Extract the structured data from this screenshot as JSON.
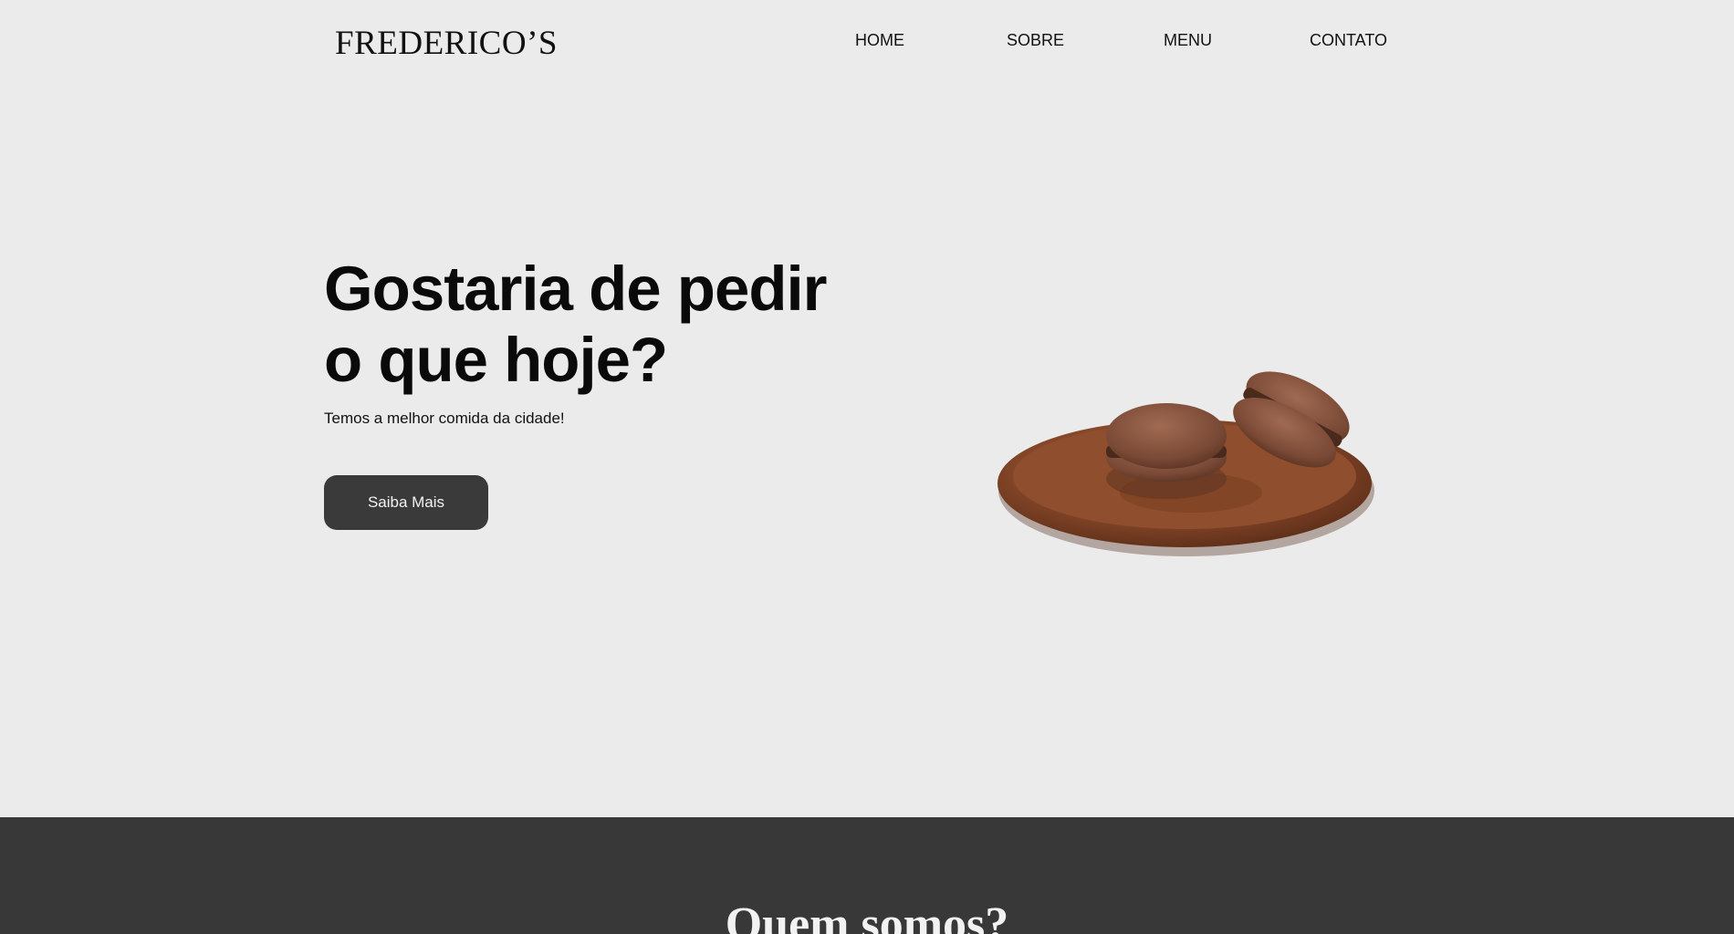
{
  "header": {
    "logo": "FREDERICO’S",
    "nav": [
      "HOME",
      "SOBRE",
      "MENU",
      "CONTATO"
    ]
  },
  "hero": {
    "title_line1": "Gostaria de pedir",
    "title_line2": "o que hoje?",
    "subtitle": "Temos a melhor comida da cidade!",
    "cta_label": "Saiba Mais",
    "image": "macarons-on-plate"
  },
  "about": {
    "title": "Quem somos?"
  },
  "colors": {
    "background": "#ebebeb",
    "dark": "#383838",
    "button": "#3a3a3a",
    "plate": "#8a4a2b"
  }
}
